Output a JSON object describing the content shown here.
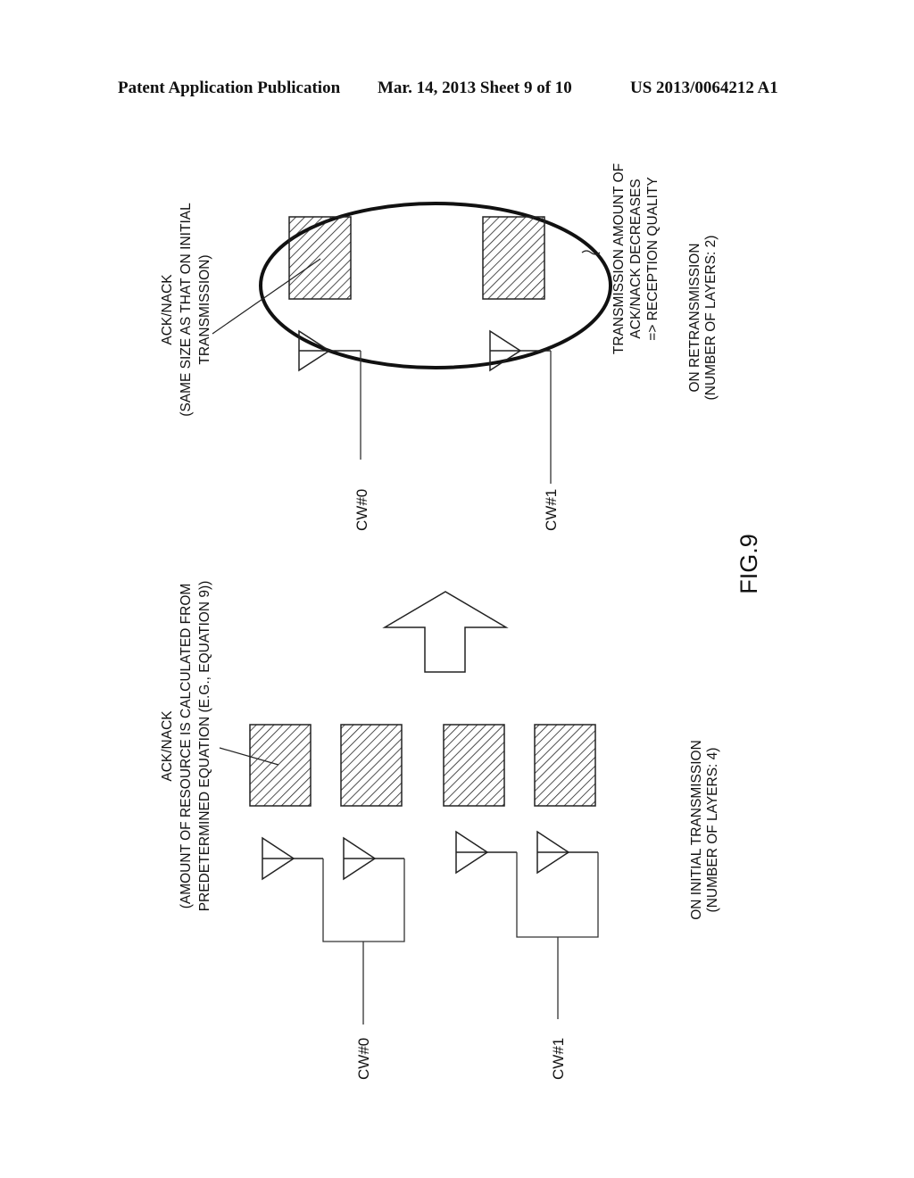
{
  "header": {
    "left": "Patent Application Publication",
    "middle": "Mar. 14, 2013  Sheet 9 of 10",
    "right": "US 2013/0064212 A1"
  },
  "figure": {
    "label": "FIG.9",
    "initial": {
      "caption_line1": "ON INITIAL TRANSMISSION",
      "caption_line2": "(NUMBER OF LAYERS: 4)",
      "callout_line1": "ACK/NACK",
      "callout_line2": "(AMOUNT OF RESOURCE IS CALCULATED FROM",
      "callout_line3": "PREDETERMINED EQUATION (E.G., EQUATION 9))",
      "cw0": "CW#0",
      "cw1": "CW#1"
    },
    "retransmission": {
      "caption_line1": "ON RETRANSMISSION",
      "caption_line2": "(NUMBER OF LAYERS: 2)",
      "callout_line1": "ACK/NACK",
      "callout_line2": "(SAME SIZE AS THAT ON INITIAL",
      "callout_line3": "TRANSMISSION)",
      "note_line1": "TRANSMISSION AMOUNT OF",
      "note_line2": "ACK/NACK DECREASES",
      "note_line3": "=> RECEPTION QUALITY",
      "cw0": "CW#0",
      "cw1": "CW#1"
    }
  }
}
